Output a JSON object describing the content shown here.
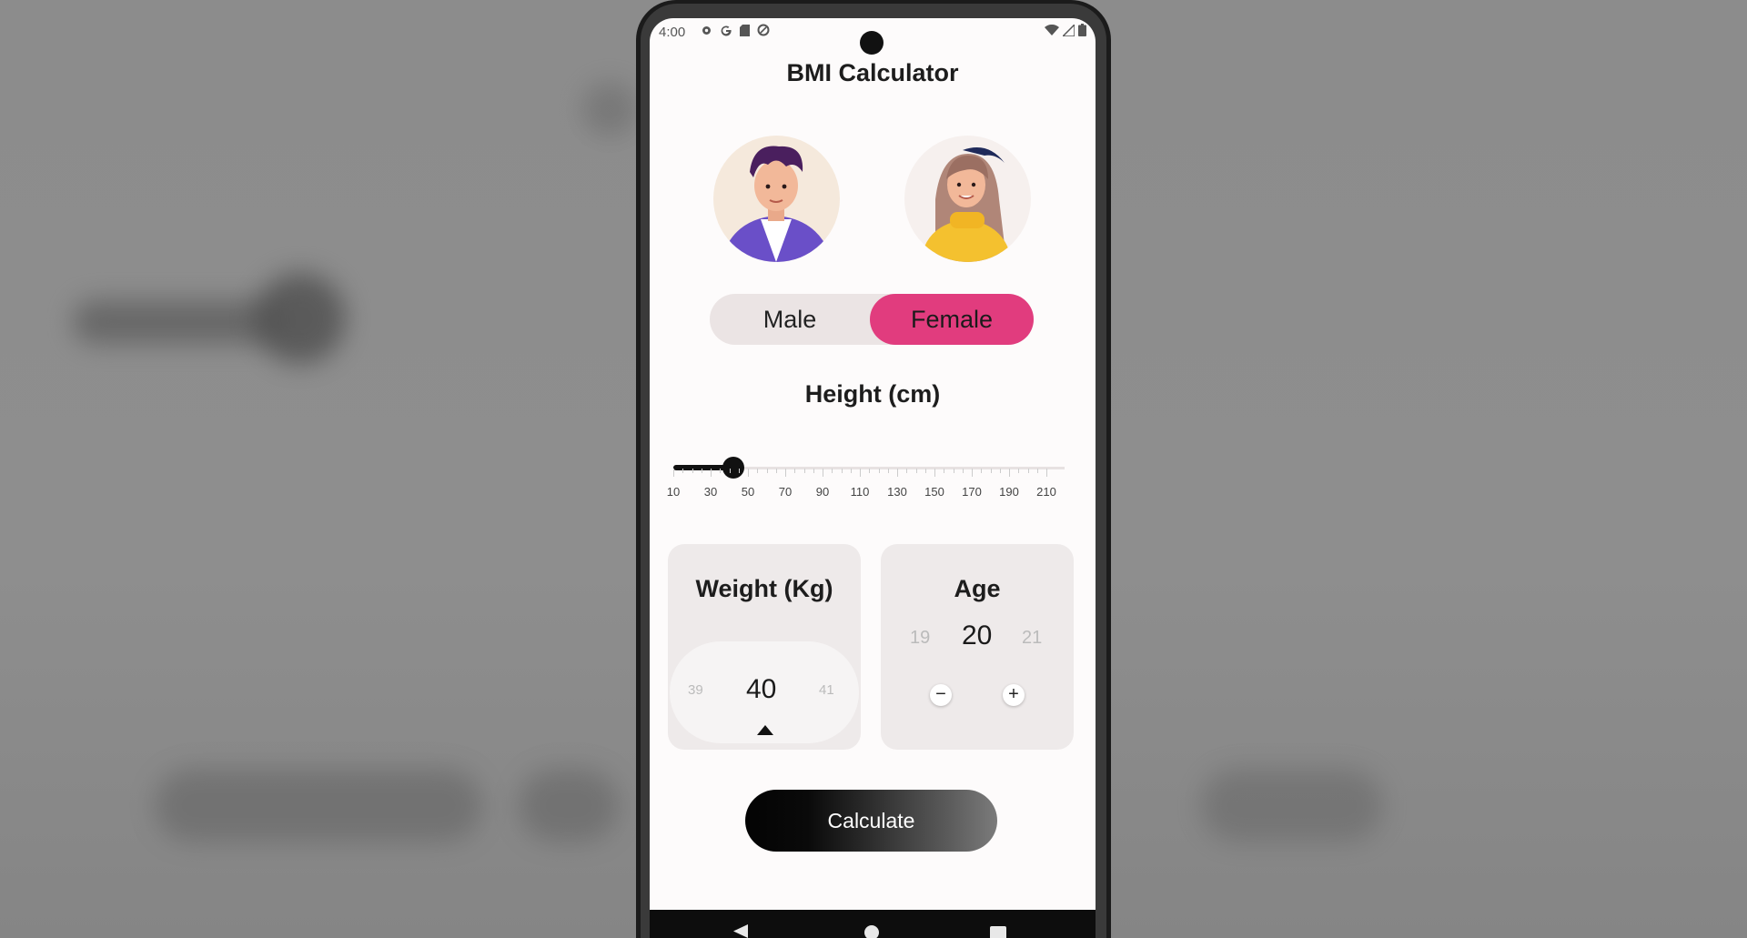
{
  "status_bar": {
    "time": "4:00"
  },
  "app": {
    "title": "BMI Calculator"
  },
  "gender": {
    "male_label": "Male",
    "female_label": "Female",
    "selected": "Female"
  },
  "height": {
    "label": "Height (cm)",
    "ticks": [
      "10",
      "30",
      "50",
      "70",
      "90",
      "110",
      "130",
      "150",
      "170",
      "190",
      "210"
    ],
    "value": 42
  },
  "weight": {
    "label": "Weight (Kg)",
    "prev": "39",
    "value": "40",
    "next": "41"
  },
  "age": {
    "label": "Age",
    "prev": "19",
    "value": "20",
    "next": "21",
    "minus": "−",
    "plus": "+"
  },
  "calculate_label": "Calculate",
  "colors": {
    "accent": "#e13c7e",
    "button_dark": "#050505"
  }
}
